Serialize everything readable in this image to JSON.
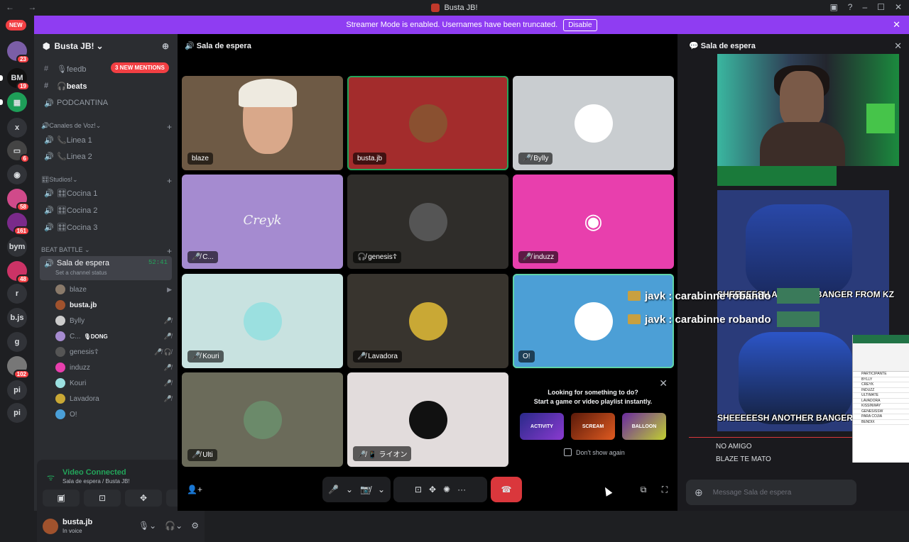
{
  "window": {
    "title": "Busta JB!",
    "nav": "← →",
    "controls": [
      "▣",
      "?",
      "–",
      "☐",
      "✕"
    ]
  },
  "banner": {
    "text": "Streamer Mode is enabled. Usernames have been truncated.",
    "button": "Disable"
  },
  "guilds": {
    "new_badge": "NEW",
    "items": [
      {
        "label": "",
        "badge": "23",
        "color": "#7b5ea7"
      },
      {
        "label": "BM",
        "badge": "19",
        "color": "#111111"
      },
      {
        "label": "▦",
        "badge": "",
        "color": "#1e9e58"
      },
      {
        "label": "x",
        "badge": "",
        "color": "#313338"
      },
      {
        "label": "▭",
        "badge": "6",
        "color": "#444"
      },
      {
        "label": "◉",
        "badge": "",
        "color": "#313338"
      },
      {
        "label": "",
        "badge": "58",
        "color": "#d04a8a"
      },
      {
        "label": "",
        "badge": "161",
        "color": "#7a2a8a"
      },
      {
        "label": "bym",
        "badge": "",
        "color": "#313338"
      },
      {
        "label": "",
        "badge": "48",
        "color": "#cc3366"
      },
      {
        "label": "r",
        "badge": "",
        "color": "#313338"
      },
      {
        "label": "b.js",
        "badge": "",
        "color": "#313338"
      },
      {
        "label": "g",
        "badge": "",
        "color": "#313338"
      },
      {
        "label": "",
        "badge": "102",
        "color": "#777"
      },
      {
        "label": "pi",
        "badge": "",
        "color": "#313338"
      },
      {
        "label": "pi",
        "badge": "",
        "color": "#313338"
      }
    ]
  },
  "server": {
    "name": "Busta JB!",
    "mentions": "3 NEW MENTIONS"
  },
  "channels": [
    {
      "icon": "#",
      "label": "🎙feedb",
      "bright": false
    },
    {
      "icon": "#",
      "label": "🎧beats",
      "bright": true
    },
    {
      "icon": "",
      "label": "PODCANTINA",
      "bright": false
    }
  ],
  "categories": {
    "voice": "🔊Canales de Voz!",
    "studios": "🎛Studios!",
    "battle": "BEAT BATTLE"
  },
  "voice_channels": [
    "📞Linea 1",
    "📞Linea 2"
  ],
  "studio_channels": [
    "🎛Cocina 1",
    "🎛Cocina 2",
    "🎛Cocina 3"
  ],
  "active_channel": {
    "name": "Sala de espera",
    "timer": "52:41",
    "status": "Set a channel status"
  },
  "members": [
    {
      "name": "blaze",
      "icon": "▶",
      "color": "#8a7a6a",
      "me": false,
      "tag": ""
    },
    {
      "name": "busta.jb",
      "icon": "",
      "color": "#a0522d",
      "me": true,
      "tag": ""
    },
    {
      "name": "Bylly",
      "icon": "🎤̸",
      "color": "#cccccc",
      "me": false,
      "tag": ""
    },
    {
      "name": "C...",
      "icon": "🎤̸",
      "color": "#a68bd0",
      "me": false,
      "tag": "🎙DONG"
    },
    {
      "name": "genesis☦",
      "icon": "🎤̸ 🎧̸",
      "color": "#555555",
      "me": false,
      "tag": ""
    },
    {
      "name": "induzz",
      "icon": "🎤̸",
      "color": "#e83fad",
      "me": false,
      "tag": ""
    },
    {
      "name": "Kouri",
      "icon": "🎤̸",
      "color": "#9be0e0",
      "me": false,
      "tag": ""
    },
    {
      "name": "Lavadora",
      "icon": "🎤̸",
      "color": "#c9a835",
      "me": false,
      "tag": ""
    },
    {
      "name": "O!",
      "icon": "",
      "color": "#4a9fd8",
      "me": false,
      "tag": ""
    }
  ],
  "voice_panel": {
    "title": "Video Connected",
    "sub": "Sala de espera / Busta JB!",
    "buttons": [
      "▣̸",
      "⊡",
      "✥",
      "✺"
    ]
  },
  "user_panel": {
    "name": "busta.jb",
    "status": "In voice"
  },
  "stage": {
    "header": "Sala de espera",
    "tiles": [
      {
        "label": "blaze",
        "bg": "#6e5a45",
        "avatar": "",
        "avatar_color": ""
      },
      {
        "label": "busta.jb",
        "bg": "#a32c2c",
        "avatar": "face",
        "avatar_color": "#8a5030"
      },
      {
        "label": "🎤̸ Bylly",
        "bg": "#c9cdd0",
        "avatar": "face",
        "avatar_color": "#ffffff"
      },
      {
        "label": "🎤̸ C...",
        "bg": "#a58bd0",
        "avatar": "text",
        "avatar_color": ""
      },
      {
        "label": "🎧̸ genesis☦",
        "bg": "#2f2d2a",
        "avatar": "face",
        "avatar_color": "#555"
      },
      {
        "label": "🎤̸ induzz",
        "bg": "#e83fad",
        "avatar": "discord",
        "avatar_color": "#fff"
      },
      {
        "label": "🎤̸ Kouri",
        "bg": "#c8e2e0",
        "avatar": "face",
        "avatar_color": "#9be0e0"
      },
      {
        "label": "🎤̸ Lavadora",
        "bg": "#38342e",
        "avatar": "face",
        "avatar_color": "#c9a835"
      },
      {
        "label": "O!",
        "bg": "#4c9fd6",
        "avatar": "face",
        "avatar_color": "#ffffff"
      },
      {
        "label": "🎤̸ Ulti",
        "bg": "#6b6b5a",
        "avatar": "face",
        "avatar_color": "#6b8a6a"
      },
      {
        "label": "🎤̸ 📱 ライオン",
        "bg": "#e2dcdc",
        "avatar": "face",
        "avatar_color": "#111111"
      }
    ],
    "logo_text": "Creyk",
    "prompt": {
      "line1": "Looking for something to do?",
      "line2": "Start a game or video playlist instantly.",
      "activities": [
        "ACTIVITY",
        "SCREAM",
        "BALLOON"
      ],
      "checkbox": "Don't show again"
    },
    "controls": {
      "mic": "🎤",
      "cam": "📷̸",
      "share": "⊡",
      "apps": "✥",
      "sound": "✺",
      "more": "···",
      "end": "☎",
      "popout": "⧉",
      "fullscreen": "⛶"
    }
  },
  "right": {
    "header": "Sala de espera",
    "meme_captions": [
      "SHEEEEESH ANOTHER BANGER FROM KZ",
      "SHEEEEESH ANOTHER BANGER"
    ],
    "overlay_chat": [
      {
        "user": "javk",
        "text": "carabinne robando"
      },
      {
        "user": "javk",
        "text": "carabinne robando"
      }
    ],
    "messages": [
      "NO AMIGO",
      "BLAZE TE MATO"
    ],
    "composer_placeholder": "Message Sala de espera",
    "sheet_rows": [
      "PARTICIPANTE",
      "BYLLY",
      "CREYK",
      "INDUZZ",
      "ULTIMATE",
      "LAVADORA",
      "KISSINWAY",
      "GENESISSW",
      "PARA COJIA",
      "BENDIX"
    ]
  }
}
